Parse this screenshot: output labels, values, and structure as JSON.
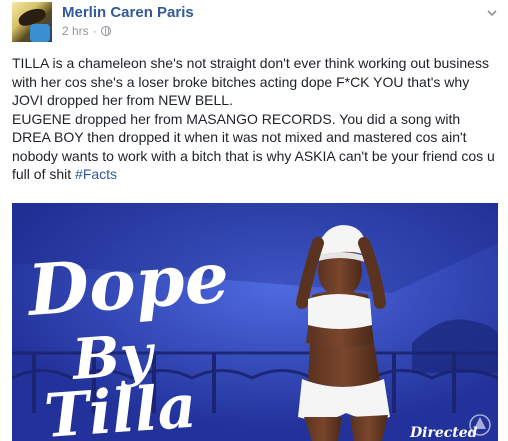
{
  "post": {
    "author_name": "Merlin Caren Paris",
    "time": "2 hrs",
    "separator": "·",
    "paragraph_1": "TILLA is a chameleon she's not straight don't ever think working out business with her cos she's a loser broke bitches acting dope F*CK YOU that's why JOVI dropped her from NEW BELL.",
    "paragraph_2": "EUGENE dropped her from MASANGO RECORDS. You did a song with DREA BOY then dropped it when it was not mixed and mastered cos ain't nobody wants to work with a bitch that is why ASKIA can't be your friend cos u full of shit ",
    "hashtag": "#Facts"
  },
  "media": {
    "title_line_1": "Dope",
    "title_line_2": "By",
    "title_line_3": "Tilla",
    "credit": "Directed",
    "colors": {
      "background": "#2a3fb7",
      "title_fill": "#ffffff",
      "outfit": "#f5f5f5",
      "skin": "#6b3c24"
    }
  },
  "icons": {
    "privacy": "globe-icon",
    "options": "chevron-down-icon"
  }
}
